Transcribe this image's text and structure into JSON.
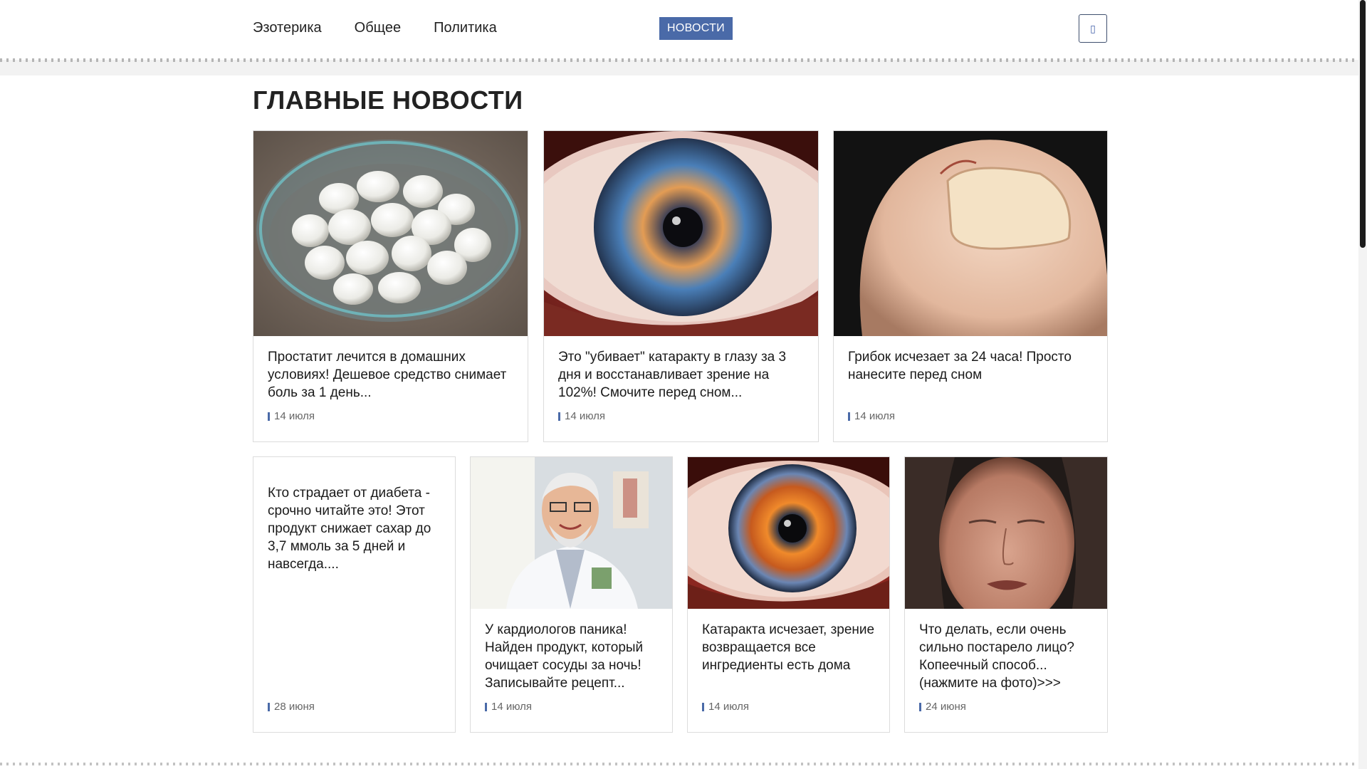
{
  "nav": {
    "items": [
      "Эзотерика",
      "Общее",
      "Политика"
    ],
    "news_badge": "НОВОСТИ",
    "search_icon": "search-icon"
  },
  "main": {
    "title": "ГЛАВНЫЕ НОВОСТИ",
    "top_cards": [
      {
        "title": "Простатит лечится в домашних условиях! Дешевое средство снимает боль за 1 день...",
        "date": "14 июля",
        "image": "boiled-quail-eggs-in-glass-bowl"
      },
      {
        "title": "Это \"убивает\" катаракту в глазу за 3 дня и восстанавливает зрение на 102%! Смочите перед сном...",
        "date": "14 июля",
        "image": "close-up-eye-iris"
      },
      {
        "title": "Грибок исчезает за 24 часа! Просто нанесите перед сном",
        "date": "14 июля",
        "image": "toenail-close-up"
      }
    ],
    "bottom_cards": [
      {
        "title": "Кто страдает от диабета - срочно читайте это! Этот продукт снижает сахар до 3,7 ммоль за 5 дней и навсегда....",
        "date": "28 июня",
        "image": ""
      },
      {
        "title": "У кардиологов паника! Найден продукт, который очищает сосуды за ночь! Записывайте рецепт...",
        "date": "14 июля",
        "image": "smiling-doctor"
      },
      {
        "title": "Катаракта исчезает, зрение возвращается все ингредиенты есть дома",
        "date": "14 июля",
        "image": "close-up-eye-iris-orange"
      },
      {
        "title": "Что делать, если очень сильно постарело лицо? Копеечный способ...(нажмите на фото)>>>",
        "date": "24 июня",
        "image": "older-woman-face"
      }
    ]
  }
}
